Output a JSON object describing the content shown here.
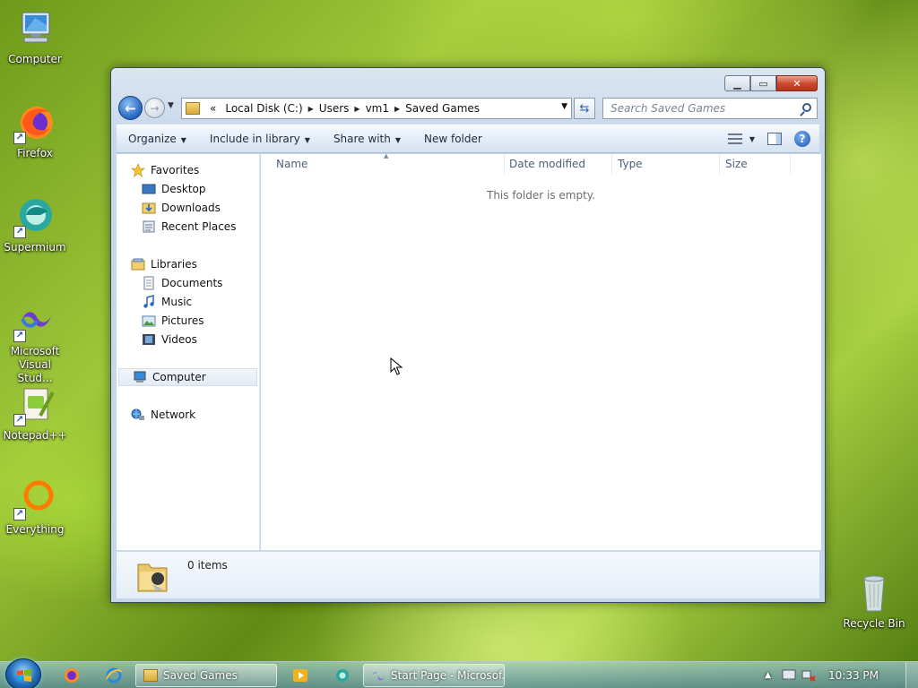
{
  "desktop": {
    "icons": [
      {
        "label": "Computer",
        "icon": "computer-icon"
      },
      {
        "label": "Firefox",
        "icon": "firefox-icon"
      },
      {
        "label": "Supermium",
        "icon": "supermium-icon"
      },
      {
        "label": "Microsoft Visual Stud...",
        "icon": "visual-studio-icon"
      },
      {
        "label": "Notepad++",
        "icon": "notepadpp-icon"
      },
      {
        "label": "Everything",
        "icon": "everything-icon"
      },
      {
        "label": "Recycle Bin",
        "icon": "recycle-bin-icon"
      }
    ]
  },
  "window": {
    "title": "Saved Games",
    "address": {
      "overflow": "«",
      "crumbs": [
        "Local Disk (C:)",
        "Users",
        "vm1",
        "Saved Games"
      ]
    },
    "search_placeholder": "Search Saved Games",
    "toolbar": {
      "organize": "Organize",
      "include_in_library": "Include in library",
      "share_with": "Share with",
      "new_folder": "New folder"
    },
    "nav": {
      "favorites": "Favorites",
      "desktop": "Desktop",
      "downloads": "Downloads",
      "recent_places": "Recent Places",
      "libraries": "Libraries",
      "documents": "Documents",
      "music": "Music",
      "pictures": "Pictures",
      "videos": "Videos",
      "computer": "Computer",
      "network": "Network"
    },
    "columns": [
      "Name",
      "Date modified",
      "Type",
      "Size"
    ],
    "empty_message": "This folder is empty.",
    "details": {
      "item_count": "0 items"
    }
  },
  "taskbar": {
    "tasks": [
      {
        "label": "Saved Games",
        "icon": "folder-icon"
      },
      {
        "label": "Start Page - Microsof...",
        "icon": "visual-studio-icon"
      }
    ],
    "clock": "10:33 PM"
  },
  "colors": {
    "accent": "#2a6cc4",
    "close_button": "#c9462c"
  }
}
